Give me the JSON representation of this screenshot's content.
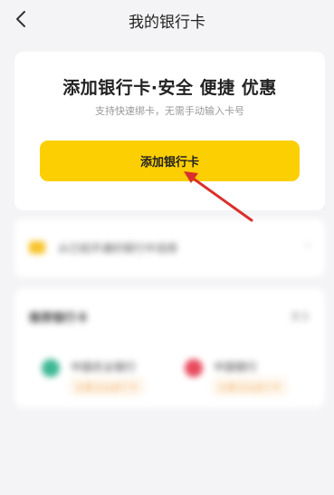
{
  "header": {
    "title": "我的银行卡",
    "back_icon": "chevron-left-icon"
  },
  "main_card": {
    "title": "添加银行卡·安全 便捷 优惠",
    "subtitle": "支持快速绑卡，无需手动输入卡号",
    "button_label": "添加银行卡",
    "button_color": "#fccf03"
  },
  "blurred_row": {
    "text": "从已经开通的银行中选择",
    "icon": "card-icon"
  },
  "banks_section": {
    "title": "推荐银行卡",
    "more": "更多",
    "banks": [
      {
        "name": "中国农业银行",
        "tag": "优惠活动进行中",
        "logo_color": "#3db894"
      },
      {
        "name": "中国银行",
        "tag": "优惠活动进行中",
        "logo_color": "#e84a5f"
      }
    ]
  },
  "annotation": {
    "arrow_color": "#d9302c"
  }
}
